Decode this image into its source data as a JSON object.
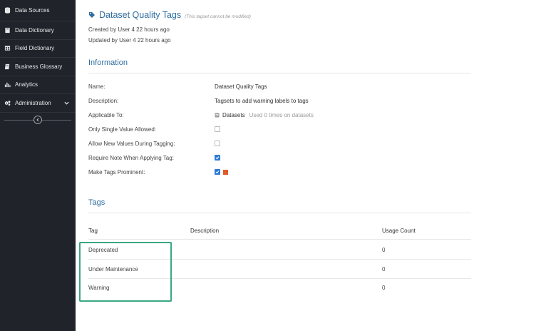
{
  "sidebar": {
    "items": [
      {
        "label": "Data Sources",
        "icon": "database-icon"
      },
      {
        "label": "Data Dictionary",
        "icon": "book-icon"
      },
      {
        "label": "Field Dictionary",
        "icon": "table-icon"
      },
      {
        "label": "Business Glossary",
        "icon": "glossary-icon"
      },
      {
        "label": "Analytics",
        "icon": "bar-chart-icon"
      },
      {
        "label": "Administration",
        "icon": "cogs-icon",
        "has_chevron": true
      }
    ],
    "collapse_icon": "chevron-left-circle-icon"
  },
  "header": {
    "title": "Dataset Quality Tags",
    "note": "(This tagset cannot be modified)",
    "created": "Created by User 4 22 hours ago",
    "updated": "Updated by User 4 22 hours ago"
  },
  "information": {
    "heading": "Information",
    "fields": [
      {
        "label": "Name:",
        "value": "Dataset Quality Tags"
      },
      {
        "label": "Description:",
        "value": "Tagsets to add warning labels to tags"
      },
      {
        "label": "Applicable To:",
        "value": "Datasets",
        "note": "Used 0 times on datasets"
      },
      {
        "label": "Only Single Value Allowed:",
        "checked": false
      },
      {
        "label": "Allow New Values During Tagging:",
        "checked": false
      },
      {
        "label": "Require Note When Applying Tag:",
        "checked": true
      },
      {
        "label": "Make Tags Prominent:",
        "checked": true,
        "color": "#e05a2b"
      }
    ]
  },
  "tags": {
    "heading": "Tags",
    "columns": [
      "Tag",
      "Description",
      "Usage Count"
    ],
    "rows": [
      {
        "tag": "Deprecated",
        "description": "",
        "usage": "0"
      },
      {
        "tag": "Under Maintenance",
        "description": "",
        "usage": "0"
      },
      {
        "tag": "Warning",
        "description": "",
        "usage": "0"
      }
    ]
  },
  "colors": {
    "sidebar_bg": "#20242a",
    "title_blue": "#2f6d9e",
    "checkbox_blue": "#2c7ad6",
    "highlight_green": "#3aa882"
  }
}
